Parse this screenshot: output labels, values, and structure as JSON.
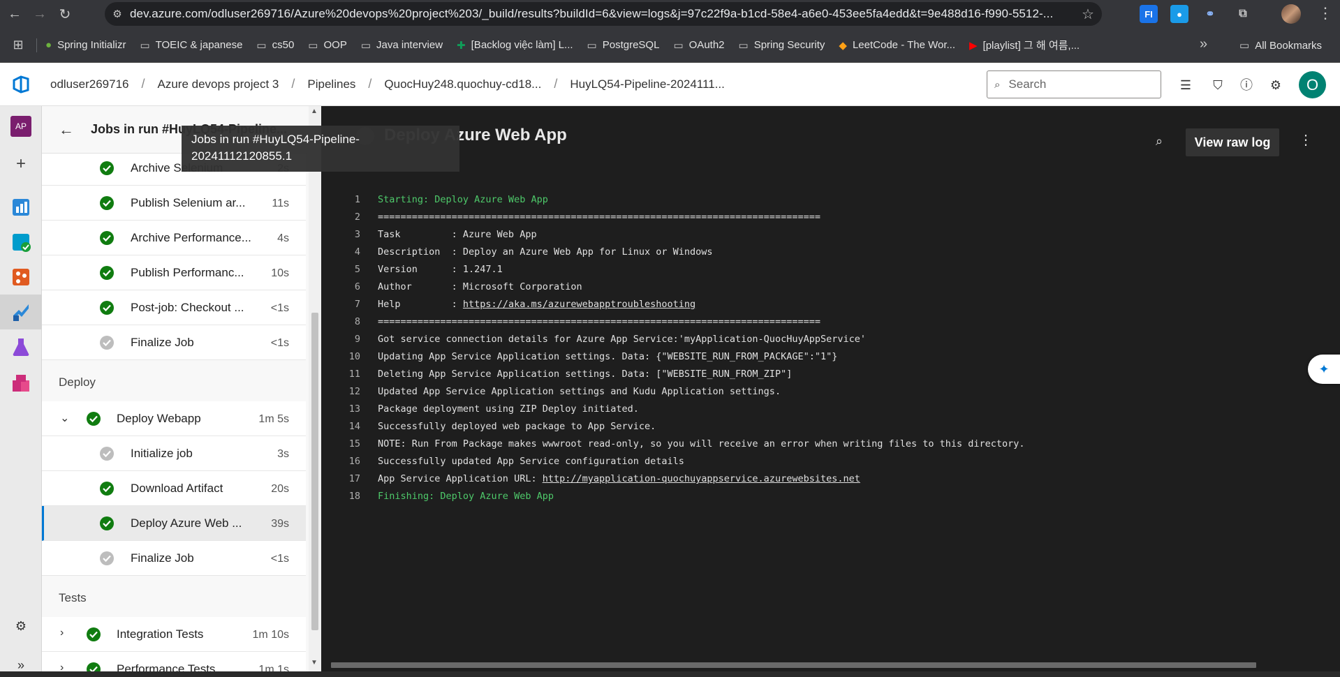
{
  "browser": {
    "url": "dev.azure.com/odluser269716/Azure%20devops%20project%203/_build/results?buildId=6&view=logs&j=97c22f9a-b1cd-58e4-a6e0-453ee5fa4edd&t=9e488d16-f990-5512-...",
    "extensions": [
      {
        "name": "fi-extension-icon",
        "label": "FI",
        "color": "#1a73e8"
      },
      {
        "name": "drop-extension-icon",
        "label": "💧",
        "color": "#1a9be8"
      },
      {
        "name": "link-extension-icon",
        "label": "🔗",
        "color": "#35363a"
      },
      {
        "name": "puzzle-extension-icon",
        "label": "⧉",
        "color": "#35363a"
      }
    ]
  },
  "bookmarks": {
    "items": [
      {
        "label": "Spring Initializr",
        "icon": "spring-icon"
      },
      {
        "label": "TOEIC & japanese",
        "icon": "folder-icon"
      },
      {
        "label": "cs50",
        "icon": "folder-icon"
      },
      {
        "label": "OOP",
        "icon": "folder-icon"
      },
      {
        "label": "Java interview",
        "icon": "folder-icon"
      },
      {
        "label": "[Backlog việc làm] L...",
        "icon": "sheets-icon"
      },
      {
        "label": "PostgreSQL",
        "icon": "folder-icon"
      },
      {
        "label": "OAuth2",
        "icon": "folder-icon"
      },
      {
        "label": "Spring Security",
        "icon": "folder-icon"
      },
      {
        "label": "LeetCode - The Wor...",
        "icon": "leetcode-icon"
      },
      {
        "label": "[playlist] 그 해 여름,...",
        "icon": "youtube-icon"
      }
    ],
    "more": "»",
    "all_label": "All Bookmarks"
  },
  "header": {
    "breadcrumbs": [
      "odluser269716",
      "Azure devops project 3",
      "Pipelines",
      "QuocHuy248.quochuy-cd18...",
      "HuyLQ54-Pipeline-2024111..."
    ],
    "search_placeholder": "Search",
    "avatar_initial": "O"
  },
  "rail": {
    "project_badge": "AP"
  },
  "jobs": {
    "title": "Jobs in run #HuyLQ54-Pipeline...",
    "tooltip": "Jobs in run #HuyLQ54-Pipeline-20241112120855.1",
    "steps_top": [
      {
        "label": "Archive Selenium",
        "duration": "2s",
        "status": "success"
      },
      {
        "label": "Publish Selenium ar...",
        "duration": "11s",
        "status": "success"
      },
      {
        "label": "Archive Performance...",
        "duration": "4s",
        "status": "success"
      },
      {
        "label": "Publish Performanc...",
        "duration": "10s",
        "status": "success"
      },
      {
        "label": "Post-job: Checkout ...",
        "duration": "<1s",
        "status": "success"
      },
      {
        "label": "Finalize Job",
        "duration": "<1s",
        "status": "skipped"
      }
    ],
    "stage_deploy": "Deploy",
    "deploy_job": {
      "label": "Deploy Webapp",
      "duration": "1m 5s",
      "status": "success"
    },
    "deploy_steps": [
      {
        "label": "Initialize job",
        "duration": "3s",
        "status": "skipped"
      },
      {
        "label": "Download Artifact",
        "duration": "20s",
        "status": "success"
      },
      {
        "label": "Deploy Azure Web ...",
        "duration": "39s",
        "status": "success",
        "selected": true
      },
      {
        "label": "Finalize Job",
        "duration": "<1s",
        "status": "skipped"
      }
    ],
    "stage_tests": "Tests",
    "test_jobs": [
      {
        "label": "Integration Tests",
        "duration": "1m 10s",
        "status": "success"
      },
      {
        "label": "Performance Tests",
        "duration": "1m 1s",
        "status": "success"
      }
    ]
  },
  "log": {
    "title": "Deploy Azure Web App",
    "raw_button": "View raw log",
    "lines": [
      {
        "n": "1",
        "text": "Starting: Deploy Azure Web App",
        "style": "green"
      },
      {
        "n": "2",
        "text": "==============================================================================",
        "style": "normal"
      },
      {
        "n": "3",
        "text": "Task         : Azure Web App",
        "style": "normal"
      },
      {
        "n": "4",
        "text": "Description  : Deploy an Azure Web App for Linux or Windows",
        "style": "normal"
      },
      {
        "n": "5",
        "text": "Version      : 1.247.1",
        "style": "normal"
      },
      {
        "n": "6",
        "text": "Author       : Microsoft Corporation",
        "style": "normal"
      },
      {
        "n": "7",
        "text": "Help         : ",
        "link": "https://aka.ms/azurewebapptroubleshooting",
        "style": "normal"
      },
      {
        "n": "8",
        "text": "==============================================================================",
        "style": "normal"
      },
      {
        "n": "9",
        "text": "Got service connection details for Azure App Service:'myApplication-QuocHuyAppService'",
        "style": "normal"
      },
      {
        "n": "10",
        "text": "Updating App Service Application settings. Data: {\"WEBSITE_RUN_FROM_PACKAGE\":\"1\"}",
        "style": "normal"
      },
      {
        "n": "11",
        "text": "Deleting App Service Application settings. Data: [\"WEBSITE_RUN_FROM_ZIP\"]",
        "style": "normal"
      },
      {
        "n": "12",
        "text": "Updated App Service Application settings and Kudu Application settings.",
        "style": "normal"
      },
      {
        "n": "13",
        "text": "Package deployment using ZIP Deploy initiated.",
        "style": "normal"
      },
      {
        "n": "14",
        "text": "Successfully deployed web package to App Service.",
        "style": "normal"
      },
      {
        "n": "15",
        "text": "NOTE: Run From Package makes wwwroot read-only, so you will receive an error when writing files to this directory.",
        "style": "normal"
      },
      {
        "n": "16",
        "text": "Successfully updated App Service configuration details",
        "style": "normal"
      },
      {
        "n": "17",
        "text": "App Service Application URL: ",
        "link": "http://myapplication-quochuyappservice.azurewebsites.net",
        "style": "normal"
      },
      {
        "n": "18",
        "text": "Finishing: Deploy Azure Web App",
        "style": "green"
      }
    ]
  },
  "colors": {
    "success": "#107c10",
    "skipped": "#bdbdbd",
    "accent": "#0078d4",
    "log_green": "#4ec96a"
  }
}
